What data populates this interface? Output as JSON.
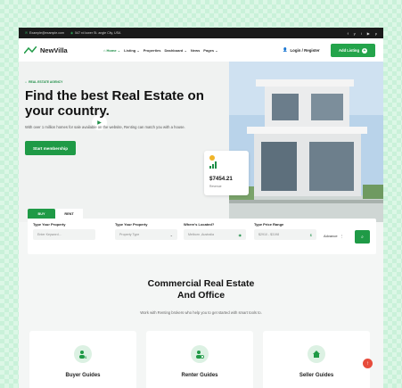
{
  "topbar": {
    "email": "Example@example.com",
    "address": "547 rd lower St. angle City, USA",
    "social": [
      "f",
      "y",
      "i",
      "▶",
      "p"
    ]
  },
  "nav": {
    "brand": "NewVilla",
    "menu": [
      "Home ⌄",
      "Listing ⌄",
      "Properties",
      "Dashboard ⌄",
      "News",
      "Pages ⌄"
    ],
    "login": "Login / Register",
    "add_listing": "Add Listing"
  },
  "hero": {
    "tag": "REAL ESTATE AGENCY",
    "title": "Find the best Real Estate on your country.",
    "description": "With over 1 million homes for sale available on the website, Renting can match you with a house.",
    "cta": "Start membership",
    "price": "$7454.21",
    "price_label": "Revenue"
  },
  "search": {
    "tabs": [
      "BUY",
      "RENT"
    ],
    "fields": [
      {
        "label": "Type Your Property",
        "placeholder": "Enter Keyword..."
      },
      {
        "label": "Type Your Property",
        "placeholder": "Property Type"
      },
      {
        "label": "Where's Located?",
        "placeholder": "Melborn ,Australia"
      },
      {
        "label": "Type Price Range",
        "placeholder": "$2910 - $3198"
      }
    ],
    "advance": "Advance"
  },
  "section": {
    "title_line1": "Commercial Real Estate",
    "title_line2": "And Office",
    "subtitle": "Work with Renting brokers who help you to get started with smart tools to.",
    "cards": [
      "Buyer Guides",
      "Renter Guides",
      "Seller Guides"
    ]
  },
  "colors": {
    "brand": "#1f9a46",
    "dark": "#1a1a1a",
    "alert": "#e74c3c"
  }
}
